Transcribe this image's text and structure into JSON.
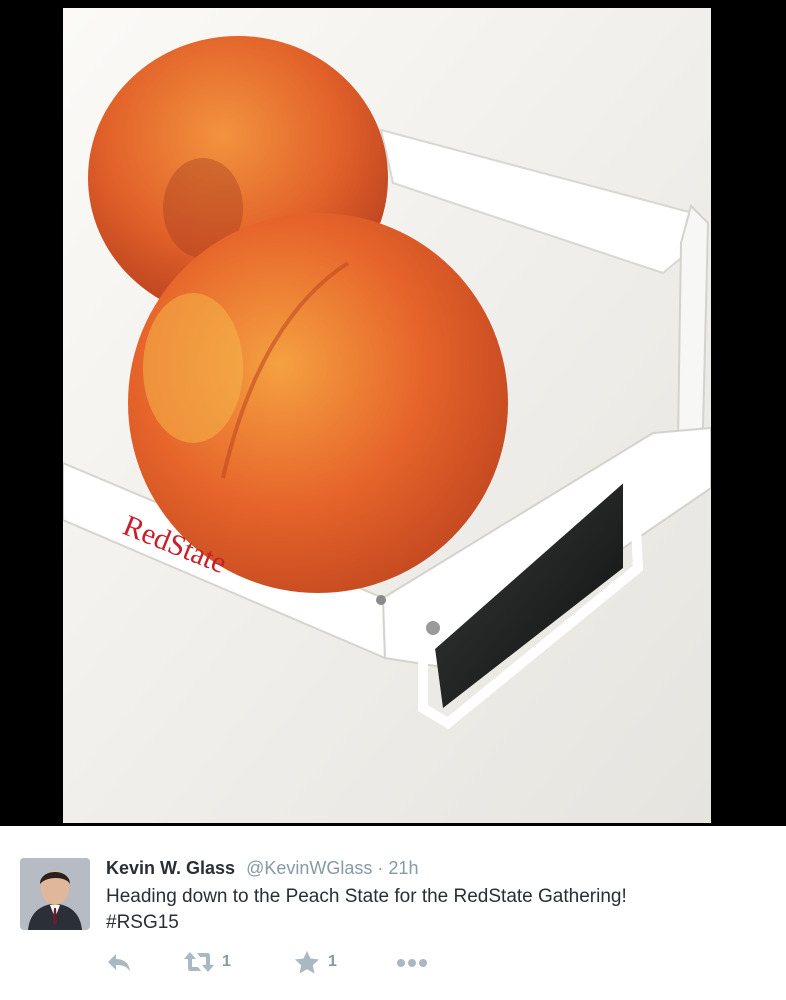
{
  "photo": {
    "brand_text": "RedState"
  },
  "tweet": {
    "author_name": "Kevin W. Glass",
    "author_handle": "@KevinWGlass",
    "separator": "·",
    "time": "21h",
    "text_line1": "Heading down to the Peach State for the RedState Gathering!",
    "text_line2": "#RSG15"
  },
  "actions": {
    "reply_icon": "reply-icon",
    "retweet_icon": "retweet-icon",
    "retweet_count": "1",
    "favorite_icon": "star-icon",
    "favorite_count": "1",
    "more_icon": "more-icon"
  },
  "colors": {
    "brand_red": "#c8202a",
    "text_dark": "#292f33",
    "text_muted": "#8899a6",
    "icon_muted": "#aab8c2"
  }
}
